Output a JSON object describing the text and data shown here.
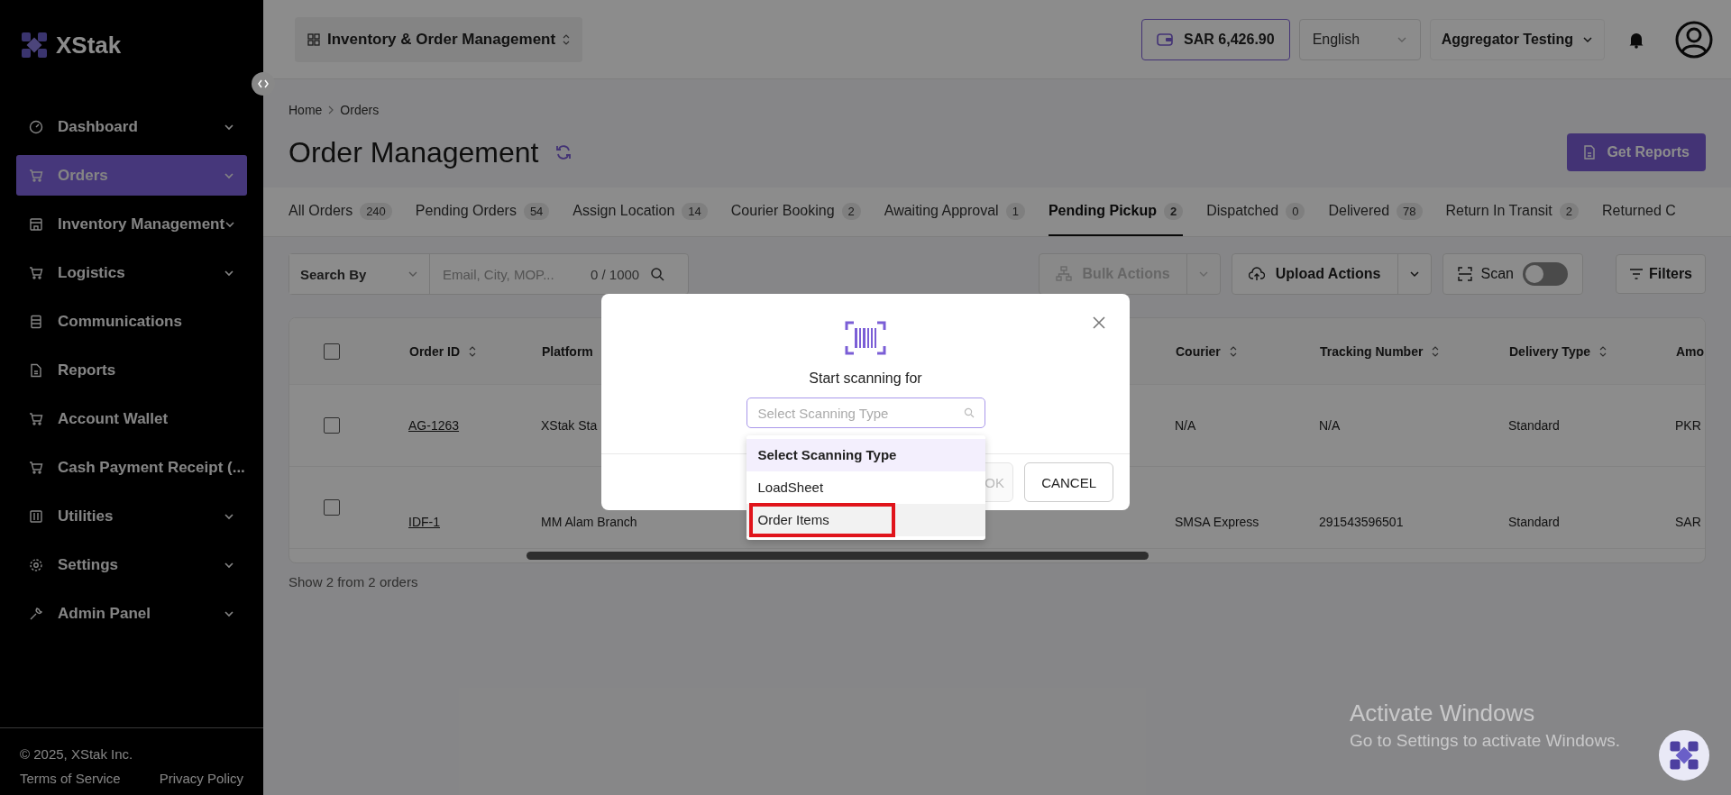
{
  "logo": {
    "text": "XStak"
  },
  "sidebar": {
    "items": [
      {
        "label": "Dashboard",
        "kind": "gauge",
        "expandable": true,
        "selected": false
      },
      {
        "label": "Orders",
        "kind": "cart",
        "expandable": true,
        "selected": true
      },
      {
        "label": "Inventory Management",
        "kind": "store",
        "expandable": true,
        "selected": false
      },
      {
        "label": "Logistics",
        "kind": "cart",
        "expandable": true,
        "selected": false
      },
      {
        "label": "Communications",
        "kind": "list",
        "expandable": false,
        "selected": false
      },
      {
        "label": "Reports",
        "kind": "doc",
        "expandable": false,
        "selected": false
      },
      {
        "label": "Account Wallet",
        "kind": "cart",
        "expandable": false,
        "selected": false
      },
      {
        "label": "Cash Payment Receipt (...",
        "kind": "cart",
        "expandable": false,
        "selected": false
      },
      {
        "label": "Utilities",
        "kind": "sliders",
        "expandable": true,
        "selected": false
      },
      {
        "label": "Settings",
        "kind": "gear",
        "expandable": true,
        "selected": false
      },
      {
        "label": "Admin Panel",
        "kind": "wrench",
        "expandable": true,
        "selected": false
      }
    ],
    "footer": {
      "copyright": "© 2025, XStak Inc.",
      "links": [
        "Terms of Service",
        "Privacy Policy"
      ]
    }
  },
  "topbar": {
    "app_switcher": "Inventory & Order Management",
    "wallet": "SAR 6,426.90",
    "language": "English",
    "account": "Aggregator Testing"
  },
  "breadcrumb": [
    "Home",
    "Orders"
  ],
  "title": "Order Management",
  "get_reports": "Get Reports",
  "tabs": [
    {
      "label": "All Orders",
      "count": "240",
      "selected": false
    },
    {
      "label": "Pending Orders",
      "count": "54",
      "selected": false
    },
    {
      "label": "Assign Location",
      "count": "14",
      "selected": false
    },
    {
      "label": "Courier Booking",
      "count": "2",
      "selected": false
    },
    {
      "label": "Awaiting Approval",
      "count": "1",
      "selected": false
    },
    {
      "label": "Pending Pickup",
      "count": "2",
      "selected": true
    },
    {
      "label": "Dispatched",
      "count": "0",
      "selected": false
    },
    {
      "label": "Delivered",
      "count": "78",
      "selected": false
    },
    {
      "label": "Return In Transit",
      "count": "2",
      "selected": false
    },
    {
      "label": "Returned C",
      "selected": false
    }
  ],
  "toolbar": {
    "search_by": "Search By",
    "search": {
      "placeholder": "Email, City, MOP...",
      "counter": "0 / 1000"
    },
    "bulk_actions": {
      "label": "Bulk Actions",
      "disabled": true
    },
    "upload_actions": "Upload Actions",
    "scan": {
      "label": "Scan",
      "on": false
    },
    "filters": "Filters"
  },
  "table": {
    "select_all_checked": false,
    "columns": [
      "Order ID",
      "Platform",
      "Courier",
      "Tracking Number",
      "Delivery Type",
      "Amo"
    ],
    "rows": [
      {
        "checked": false,
        "cells": [
          "AG-1263",
          "XStak Sta",
          "N/A",
          "N/A",
          "Standard",
          "PKR"
        ]
      },
      {
        "checked": false,
        "cells": [
          "IDF-1",
          "MM Alam Branch",
          "SMSA Express",
          "291543596501",
          "Standard",
          "SAR"
        ]
      }
    ],
    "footer": "Show 2 from 2 orders"
  },
  "modal": {
    "prompt": "Start scanning for",
    "select": {
      "placeholder": "Select Scanning Type"
    },
    "options": [
      {
        "label": "Select Scanning Type",
        "selected": true,
        "hovered": false,
        "highlighted": false
      },
      {
        "label": "LoadSheet",
        "selected": false,
        "hovered": false,
        "highlighted": false
      },
      {
        "label": "Order Items",
        "selected": false,
        "hovered": true,
        "highlighted": true
      }
    ],
    "ok": {
      "label": "OK",
      "disabled": true
    },
    "cancel": "CANCEL"
  },
  "os_notice": {
    "title": "Activate Windows",
    "subtitle": "Go to Settings to activate Windows."
  }
}
